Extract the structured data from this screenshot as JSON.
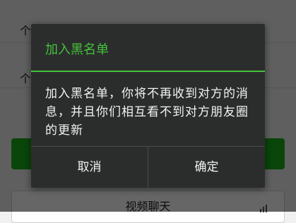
{
  "background": {
    "row1_char": "个",
    "row2_char": "个",
    "bottom_button_label": "视频聊天",
    "bottom_button_icon": "sound-icon"
  },
  "dialog": {
    "title": "加入黑名单",
    "message": "加入黑名单，你将不再收到对方的消息，并且你们相互看不到对方朋友圈的更新",
    "cancel_label": "取消",
    "confirm_label": "确定",
    "accent_color": "#44c239"
  }
}
